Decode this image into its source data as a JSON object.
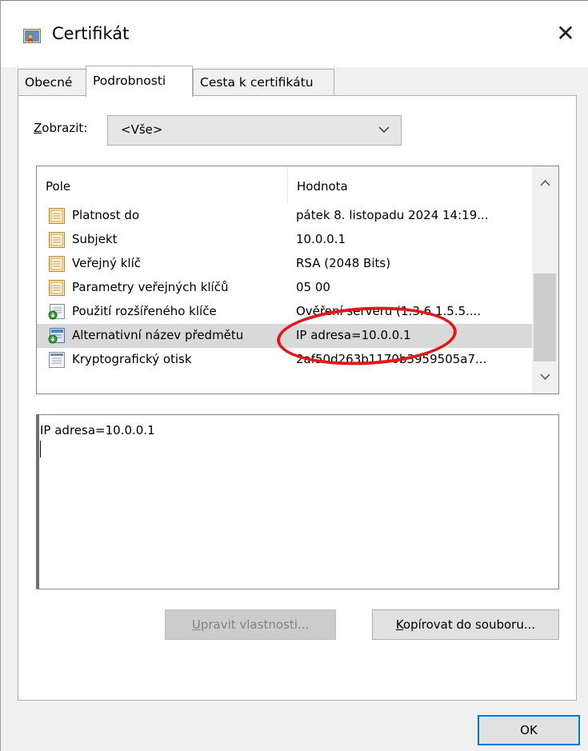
{
  "window": {
    "title": "Certifikát",
    "icon": "certificate-icon",
    "close_glyph": "✕"
  },
  "tabs": [
    {
      "label": "Obecné",
      "active": false
    },
    {
      "label": "Podrobnosti",
      "active": true
    },
    {
      "label": "Cesta k certifikátu",
      "active": false
    }
  ],
  "show": {
    "label_accel": "Z",
    "label_rest": "obrazit:",
    "value": "<Vše>"
  },
  "list": {
    "columns": [
      "Pole",
      "Hodnota"
    ],
    "rows": [
      {
        "field": "Platnost do",
        "value": "pátek 8. listopadu 2024 14:19...",
        "icon": "document-icon"
      },
      {
        "field": "Subjekt",
        "value": "10.0.0.1",
        "icon": "document-icon"
      },
      {
        "field": "Veřejný klíč",
        "value": "RSA (2048 Bits)",
        "icon": "document-icon"
      },
      {
        "field": "Parametry veřejných klíčů",
        "value": "05 00",
        "icon": "document-icon"
      },
      {
        "field": "Použití rozšířeného klíče",
        "value": "Ověření serveru (1.3.6.1.5.5....",
        "icon": "extension-icon"
      },
      {
        "field": "Alternativní název předmětu",
        "value": "IP adresa=10.0.0.1",
        "icon": "extension-icon",
        "selected": true
      },
      {
        "field": "Kryptografický otisk",
        "value": "2af50d263b1170b3959505a7...",
        "icon": "properties-icon"
      }
    ]
  },
  "detail": {
    "text": "IP adresa=10.0.0.1"
  },
  "buttons": {
    "edit_accel": "U",
    "edit_rest": "pravit vlastnosti...",
    "copy_accel": "K",
    "copy_rest": "opírovat do souboru...",
    "ok": "OK"
  },
  "colors": {
    "highlight_ring": "#e01818",
    "selected_row": "#d9d9d9",
    "focus_border": "#0078d7"
  }
}
